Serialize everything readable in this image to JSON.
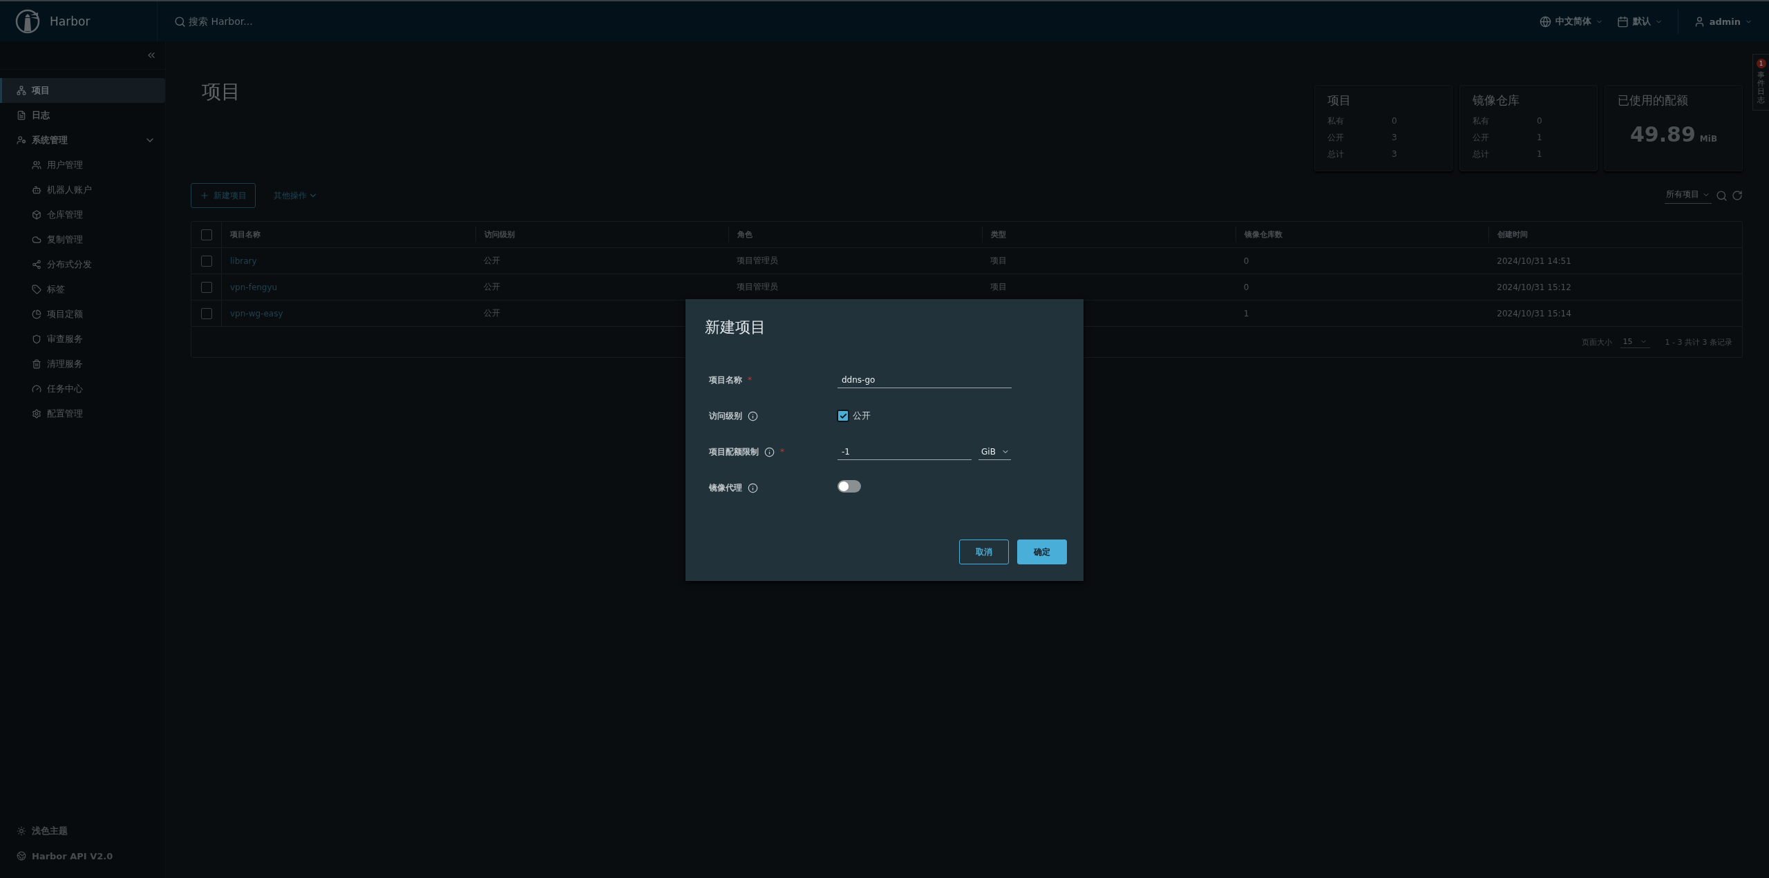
{
  "header": {
    "logo_text": "Harbor",
    "search": {
      "placeholder": "搜索 Harbor..."
    },
    "language": "中文简体",
    "theme": "默认",
    "user": "admin"
  },
  "sidebar": {
    "items": [
      {
        "label": "项目",
        "selected": true
      },
      {
        "label": "日志",
        "selected": false
      },
      {
        "label": "系统管理",
        "selected": false,
        "expanded": true,
        "children": [
          {
            "label": "用户管理",
            "selected": false
          },
          {
            "label": "机器人账户",
            "selected": false
          },
          {
            "label": "仓库管理",
            "selected": false
          },
          {
            "label": "复制管理",
            "selected": false
          },
          {
            "label": "分布式分发",
            "selected": false
          },
          {
            "label": "标签",
            "selected": false
          },
          {
            "label": "项目定额",
            "selected": false
          },
          {
            "label": "审查服务",
            "selected": false
          },
          {
            "label": "清理服务",
            "selected": false
          },
          {
            "label": "任务中心",
            "selected": false
          },
          {
            "label": "配置管理",
            "selected": false
          }
        ]
      }
    ],
    "footer": [
      "浅色主题",
      "Harbor API V2.0"
    ]
  },
  "page": {
    "title": "项目",
    "cards": [
      {
        "kind": "counts",
        "title": "项目",
        "rows": [
          {
            "label": "私有",
            "value": "0"
          },
          {
            "label": "公开",
            "value": "3"
          },
          {
            "label": "总计",
            "value": "3"
          }
        ]
      },
      {
        "kind": "counts",
        "title": "镜像仓库",
        "rows": [
          {
            "label": "私有",
            "value": "0"
          },
          {
            "label": "公开",
            "value": "1"
          },
          {
            "label": "总计",
            "value": "1"
          }
        ]
      },
      {
        "kind": "quota",
        "title": "已使用的配额",
        "value": "49.89",
        "unit": "MiB"
      }
    ],
    "toolbar": {
      "new_button": "新建项目",
      "more_actions": "其他操作",
      "filter": "所有项目"
    },
    "table": {
      "select_all_checked": false,
      "columns": [
        "项目名称",
        "访问级别",
        "角色",
        "类型",
        "镜像仓库数",
        "创建时间"
      ],
      "rows": [
        {
          "checked": false,
          "cells": [
            "library",
            "公开",
            "项目管理员",
            "项目",
            "0",
            "2024/10/31 14:51"
          ]
        },
        {
          "checked": false,
          "cells": [
            "vpn-fengyu",
            "公开",
            "项目管理员",
            "项目",
            "0",
            "2024/10/31 15:12"
          ]
        },
        {
          "checked": false,
          "cells": [
            "vpn-wg-easy",
            "公开",
            "",
            "",
            "1",
            "2024/10/31 15:14"
          ]
        }
      ],
      "footer": {
        "page_size_label": "页面大小",
        "page_size": "15",
        "summary": "1 - 3 共计 3 条记录"
      }
    }
  },
  "event_tab": {
    "label": "事件日志",
    "badge": "1"
  },
  "dialog": {
    "title": "新建项目",
    "fields": [
      {
        "kind": "text",
        "label": "项目名称",
        "required_mark": "*",
        "info": false,
        "value": "ddns-go"
      },
      {
        "kind": "checkbox",
        "label": "访问级别",
        "info": true,
        "checked": true,
        "option": "公开"
      },
      {
        "kind": "quota",
        "label": "项目配额限制",
        "required_mark": "*",
        "info": true,
        "value": "-1",
        "unit": "GiB"
      },
      {
        "kind": "toggle",
        "label": "镜像代理",
        "info": true,
        "on": false
      }
    ],
    "buttons": [
      {
        "label": "取消",
        "kind": "secondary"
      },
      {
        "label": "确定",
        "kind": "primary"
      }
    ]
  }
}
